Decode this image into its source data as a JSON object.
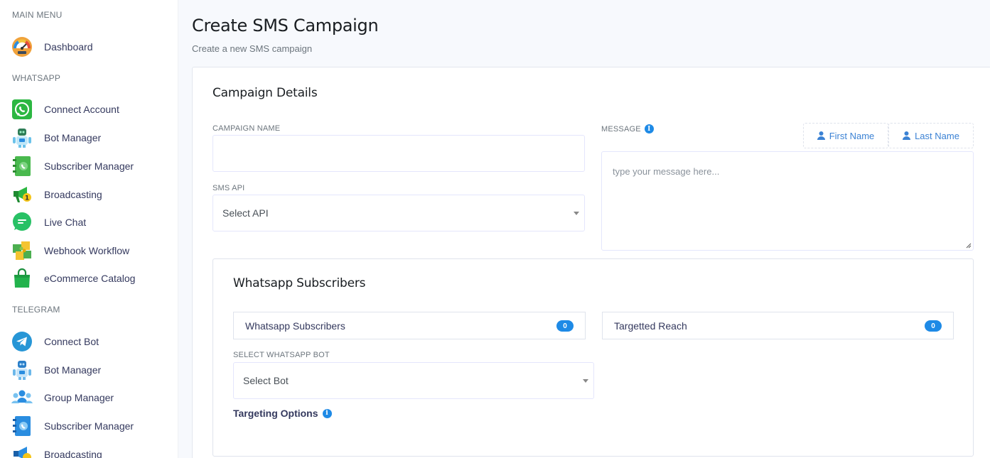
{
  "sidebar": {
    "sections": [
      {
        "header": "MAIN MENU"
      },
      {
        "header": "WHATSAPP"
      },
      {
        "header": "TELEGRAM"
      }
    ],
    "main_items": [
      {
        "label": "Dashboard",
        "icon": "speedometer-icon"
      }
    ],
    "whatsapp_items": [
      {
        "label": "Connect Account",
        "icon": "whatsapp-icon"
      },
      {
        "label": "Bot Manager",
        "icon": "robot-icon"
      },
      {
        "label": "Subscriber Manager",
        "icon": "contacts-book-icon"
      },
      {
        "label": "Broadcasting",
        "icon": "megaphone-icon"
      },
      {
        "label": "Live Chat",
        "icon": "chat-bubble-icon"
      },
      {
        "label": "Webhook Workflow",
        "icon": "puzzle-icon"
      },
      {
        "label": "eCommerce Catalog",
        "icon": "shopping-bag-icon"
      }
    ],
    "telegram_items": [
      {
        "label": "Connect Bot",
        "icon": "telegram-icon"
      },
      {
        "label": "Bot Manager",
        "icon": "robot-icon"
      },
      {
        "label": "Group Manager",
        "icon": "group-icon"
      },
      {
        "label": "Subscriber Manager",
        "icon": "contacts-book-icon"
      },
      {
        "label": "Broadcasting",
        "icon": "megaphone-icon"
      }
    ]
  },
  "page": {
    "title": "Create SMS Campaign",
    "subtitle": "Create a new SMS campaign"
  },
  "campaign": {
    "title": "Campaign Details",
    "name_label": "CAMPAIGN NAME",
    "name_value": "",
    "api_label": "SMS API",
    "api_selected": "Select API",
    "message_label": "MESSAGE",
    "message_placeholder": "type your message here...",
    "first_name_btn": "First Name",
    "last_name_btn": "Last Name"
  },
  "subscribers": {
    "title": "Whatsapp Subscribers",
    "subscribers_label": "Whatsapp Subscribers",
    "subscribers_count": "0",
    "reach_label": "Targetted Reach",
    "reach_count": "0",
    "bot_label": "SELECT WHATSAPP BOT",
    "bot_selected": "Select Bot",
    "targeting_label": "Targeting Options"
  },
  "colors": {
    "accent": "#1e8ae6",
    "sidebar_bg": "#ffffff",
    "page_bg": "#f7f9fd"
  }
}
